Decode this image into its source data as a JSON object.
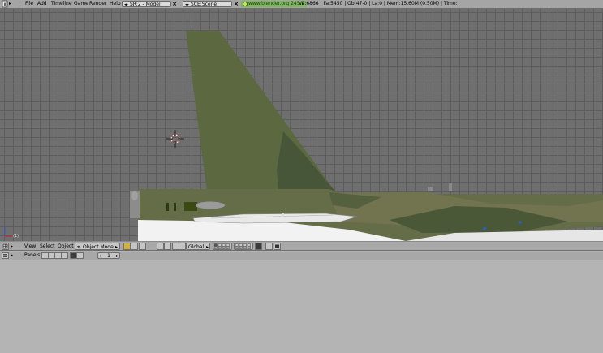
{
  "menu": {
    "items": [
      "File",
      "Add",
      "Timeline",
      "Game",
      "Render",
      "Help"
    ]
  },
  "screen": {
    "prefix": "SR:",
    "value": "2 - Model"
  },
  "scene": {
    "prefix": "SCE:",
    "value": "Scene"
  },
  "info": {
    "url": "www.blender.org 245.2",
    "stats": "Ve:6866 | Fa:5450 | Ob:47-0 | La:0 | Mem:15.60M (0.50M) | Time:"
  },
  "viewport": {
    "frame_label": "(1)"
  },
  "view_header": {
    "menus": [
      "View",
      "Select",
      "Object"
    ],
    "mode": "Object Mode",
    "orientation": "Global"
  },
  "buttons_header": {
    "panels_label": "Panels",
    "page_value": "1"
  },
  "colors": {
    "tail": "#5b6840",
    "fuselage": "#636b48",
    "camo_dark": "#4a5838",
    "belly": "#f0f0f0",
    "grid_bg": "#6f6f6f"
  }
}
